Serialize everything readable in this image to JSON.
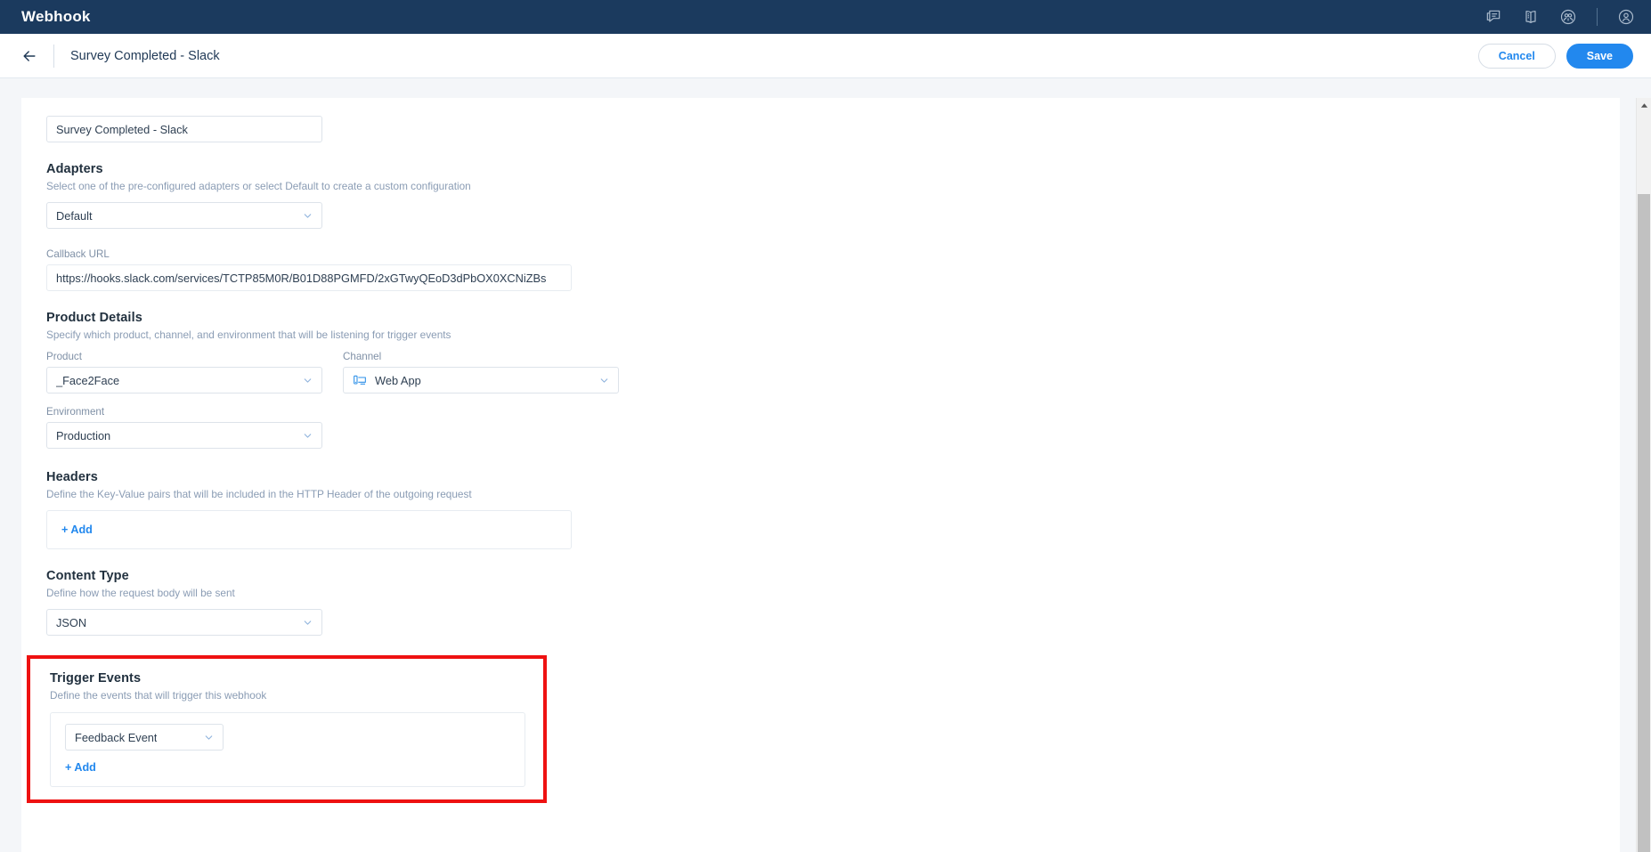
{
  "topbar": {
    "title": "Webhook",
    "icons": [
      {
        "name": "feedback-chat-icon"
      },
      {
        "name": "documentation-book-icon"
      },
      {
        "name": "community-icon"
      },
      {
        "name": "user-account-icon"
      }
    ]
  },
  "subheader": {
    "back_label": "",
    "page_title": "Survey Completed - Slack",
    "cancel_label": "Cancel",
    "save_label": "Save"
  },
  "form": {
    "name": {
      "value": "Survey Completed - Slack",
      "placeholder": "Name"
    },
    "adapters": {
      "title": "Adapters",
      "subtitle": "Select one of the pre-configured adapters or select Default to create a custom configuration",
      "value": "Default"
    },
    "callback_url": {
      "label": "Callback URL",
      "value": "https://hooks.slack.com/services/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",
      "placeholder": "Callback URL"
    },
    "product_details": {
      "title": "Product Details",
      "subtitle": "Specify which product, channel, and environment that will be listening for trigger events",
      "product_label": "Product",
      "product_value": "_Face2Face",
      "channel_label": "Channel",
      "channel_value": "Web App",
      "channel_icon": "web-app-device-icon",
      "environment_label": "Environment",
      "environment_value": "Production"
    },
    "headers": {
      "title": "Headers",
      "subtitle": "Define the Key-Value pairs that will be included in the HTTP Header of the outgoing request",
      "add_label": "+ Add"
    },
    "content_type": {
      "title": "Content Type",
      "subtitle": "Define how the request body will be sent",
      "value": "JSON"
    },
    "trigger_events": {
      "title": "Trigger Events",
      "subtitle": "Define the events that will trigger this webhook",
      "event_value": "Feedback Event",
      "add_label": "+ Add"
    }
  },
  "colors": {
    "navy": "#1b3a5e",
    "accent_blue": "#2288ee",
    "highlight_red": "#ee1111",
    "page_bg": "#f4f6f9"
  }
}
